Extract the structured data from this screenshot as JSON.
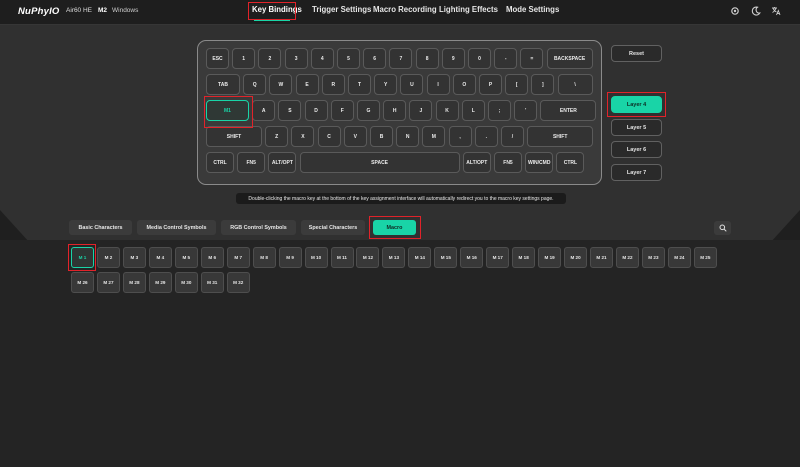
{
  "app": {
    "logo": "NuPhyIO",
    "device": "Air60 HE",
    "mode_badge": "M2",
    "os": "Windows"
  },
  "nav": {
    "key_bindings": "Key Bindings",
    "trigger_settings": "Trigger Settings",
    "macro_recording": "Macro Recording",
    "lighting_effects": "Lighting Effects",
    "mode_settings": "Mode Settings"
  },
  "keyboard": {
    "row1": [
      "ESC",
      "1",
      "2",
      "3",
      "4",
      "5",
      "6",
      "7",
      "8",
      "9",
      "0",
      "-",
      "=",
      "BACKSPACE"
    ],
    "row2": [
      "TAB",
      "Q",
      "W",
      "E",
      "R",
      "T",
      "Y",
      "U",
      "I",
      "O",
      "P",
      "[",
      "]",
      "\\"
    ],
    "row3": [
      "M1",
      "A",
      "S",
      "D",
      "F",
      "G",
      "H",
      "J",
      "K",
      "L",
      ";",
      "'",
      "ENTER"
    ],
    "row4": [
      "SHIFT",
      "Z",
      "X",
      "C",
      "V",
      "B",
      "N",
      "M",
      ",",
      ".",
      "/",
      "SHIFT"
    ],
    "row5": [
      "CTRL",
      "FN5",
      "ALT/OPT",
      "SPACE",
      "ALT/OPT",
      "FN5",
      "WIN/CMD",
      "CTRL"
    ]
  },
  "side": {
    "reset": "Reset",
    "layers": [
      "Layer 4",
      "Layer 5",
      "Layer 6",
      "Layer 7"
    ]
  },
  "hint": "Double-clicking the macro key at the bottom of the key assignment interface will automatically redirect you to the macro key settings page.",
  "categories": [
    "Basic Characters",
    "Media Control Symbols",
    "RGB Control Symbols",
    "Special Characters",
    "Macro"
  ],
  "macros_row1": [
    "M 1",
    "M 2",
    "M 3",
    "M 4",
    "M 5",
    "M 6",
    "M 7",
    "M 8",
    "M 9",
    "M 10",
    "M 11",
    "M 12",
    "M 13",
    "M 14",
    "M 15",
    "M 16",
    "M 17",
    "M 18",
    "M 19",
    "M 20",
    "M 21",
    "M 22",
    "M 23",
    "M 24",
    "M 25"
  ],
  "macros_row2": [
    "M 26",
    "M 27",
    "M 28",
    "M 29",
    "M 30",
    "M 31",
    "M 32"
  ],
  "colors": {
    "accent": "#19d4a7",
    "highlight": "#e1232a",
    "background": "#2b2b2b"
  },
  "icons": [
    "settings-icon",
    "moon-icon",
    "translate-icon",
    "search-icon"
  ]
}
